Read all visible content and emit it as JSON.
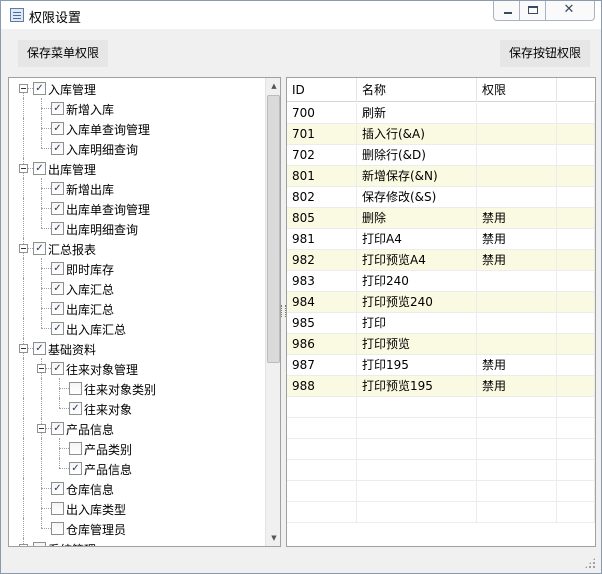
{
  "window": {
    "title": "权限设置",
    "controls": [
      "minimize",
      "maximize",
      "close"
    ]
  },
  "toolbar": {
    "save_menu_label": "保存菜单权限",
    "save_button_label": "保存按钮权限"
  },
  "tree": {
    "nodes": [
      {
        "label": "入库管理",
        "level": 0,
        "checked": true,
        "expanded": true
      },
      {
        "label": "新增入库",
        "level": 1,
        "checked": true
      },
      {
        "label": "入库单查询管理",
        "level": 1,
        "checked": true
      },
      {
        "label": "入库明细查询",
        "level": 1,
        "checked": true
      },
      {
        "label": "出库管理",
        "level": 0,
        "checked": true,
        "expanded": true
      },
      {
        "label": "新增出库",
        "level": 1,
        "checked": true
      },
      {
        "label": "出库单查询管理",
        "level": 1,
        "checked": true
      },
      {
        "label": "出库明细查询",
        "level": 1,
        "checked": true
      },
      {
        "label": "汇总报表",
        "level": 0,
        "checked": true,
        "expanded": true
      },
      {
        "label": "即时库存",
        "level": 1,
        "checked": true
      },
      {
        "label": "入库汇总",
        "level": 1,
        "checked": true
      },
      {
        "label": "出库汇总",
        "level": 1,
        "checked": true
      },
      {
        "label": "出入库汇总",
        "level": 1,
        "checked": true
      },
      {
        "label": "基础资料",
        "level": 0,
        "checked": true,
        "expanded": true
      },
      {
        "label": "往来对象管理",
        "level": 1,
        "checked": true,
        "expanded": true
      },
      {
        "label": "往来对象类别",
        "level": 2,
        "checked": false
      },
      {
        "label": "往来对象",
        "level": 2,
        "checked": true
      },
      {
        "label": "产品信息",
        "level": 1,
        "checked": true,
        "expanded": true
      },
      {
        "label": "产品类别",
        "level": 2,
        "checked": false
      },
      {
        "label": "产品信息",
        "level": 2,
        "checked": true
      },
      {
        "label": "仓库信息",
        "level": 1,
        "checked": true
      },
      {
        "label": "出入库类型",
        "level": 1,
        "checked": false
      },
      {
        "label": "仓库管理员",
        "level": 1,
        "checked": false
      },
      {
        "label": "系统管理",
        "level": 0,
        "checked": false,
        "expanded": true
      }
    ]
  },
  "grid": {
    "columns": [
      "ID",
      "名称",
      "权限"
    ],
    "rows": [
      {
        "id": "700",
        "name": "刷新",
        "perm": ""
      },
      {
        "id": "701",
        "name": "插入行(&A)",
        "perm": ""
      },
      {
        "id": "702",
        "name": "删除行(&D)",
        "perm": ""
      },
      {
        "id": "801",
        "name": "新增保存(&N)",
        "perm": ""
      },
      {
        "id": "802",
        "name": "保存修改(&S)",
        "perm": ""
      },
      {
        "id": "805",
        "name": "删除",
        "perm": "禁用"
      },
      {
        "id": "981",
        "name": "打印A4",
        "perm": "禁用"
      },
      {
        "id": "982",
        "name": "打印预览A4",
        "perm": "禁用"
      },
      {
        "id": "983",
        "name": "打印240",
        "perm": ""
      },
      {
        "id": "984",
        "name": "打印预览240",
        "perm": ""
      },
      {
        "id": "985",
        "name": "打印",
        "perm": ""
      },
      {
        "id": "986",
        "name": "打印预览",
        "perm": ""
      },
      {
        "id": "987",
        "name": "打印195",
        "perm": "禁用"
      },
      {
        "id": "988",
        "name": "打印预览195",
        "perm": "禁用"
      }
    ]
  }
}
